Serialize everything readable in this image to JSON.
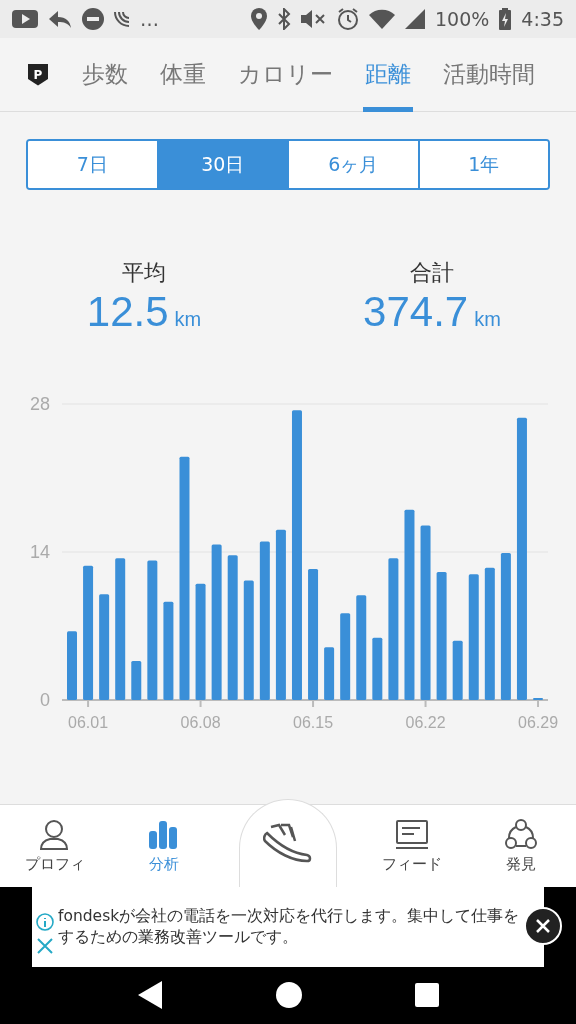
{
  "status_bar": {
    "overflow": "…",
    "battery": "100%",
    "time": "4:35"
  },
  "tabs_badge": "P",
  "tabs": [
    {
      "label": "歩数",
      "selected": false
    },
    {
      "label": "体重",
      "selected": false
    },
    {
      "label": "カロリー",
      "selected": false
    },
    {
      "label": "距離",
      "selected": true
    },
    {
      "label": "活動時間",
      "selected": false
    }
  ],
  "periods": [
    {
      "label": "7日",
      "selected": false
    },
    {
      "label": "30日",
      "selected": true
    },
    {
      "label": "6ヶ月",
      "selected": false
    },
    {
      "label": "1年",
      "selected": false
    }
  ],
  "stats": [
    {
      "label": "平均",
      "value": "12.5",
      "unit": "km"
    },
    {
      "label": "合計",
      "value": "374.7",
      "unit": "km"
    }
  ],
  "chart_data": {
    "type": "bar",
    "categories": [
      null,
      "06.01",
      null,
      null,
      null,
      null,
      null,
      null,
      "06.08",
      null,
      null,
      null,
      null,
      null,
      null,
      "06.15",
      null,
      null,
      null,
      null,
      null,
      null,
      "06.22",
      null,
      null,
      null,
      null,
      null,
      null,
      "06.29"
    ],
    "values": [
      6.5,
      12.7,
      10.0,
      13.4,
      3.7,
      13.2,
      9.3,
      23.0,
      11.0,
      14.7,
      13.7,
      11.3,
      15.0,
      16.1,
      27.4,
      12.4,
      5.0,
      8.2,
      9.9,
      5.9,
      13.4,
      18.0,
      16.5,
      12.1,
      5.6,
      11.9,
      12.5,
      13.9,
      26.7,
      0.2
    ],
    "ylim": [
      0,
      28
    ],
    "yticks": [
      0,
      14,
      28
    ]
  },
  "bottom_nav": [
    {
      "kind": "profile",
      "label": "プロフィ",
      "selected": false
    },
    {
      "kind": "analysis",
      "label": "分析",
      "selected": true
    },
    {
      "kind": "walk"
    },
    {
      "kind": "feed",
      "label": "フィード",
      "selected": false
    },
    {
      "kind": "discover",
      "label": "発見",
      "selected": false
    }
  ],
  "ad": {
    "text": "fondeskが会社の電話を一次対応を代行します。集中して仕事をするための業務改善ツールです。"
  }
}
